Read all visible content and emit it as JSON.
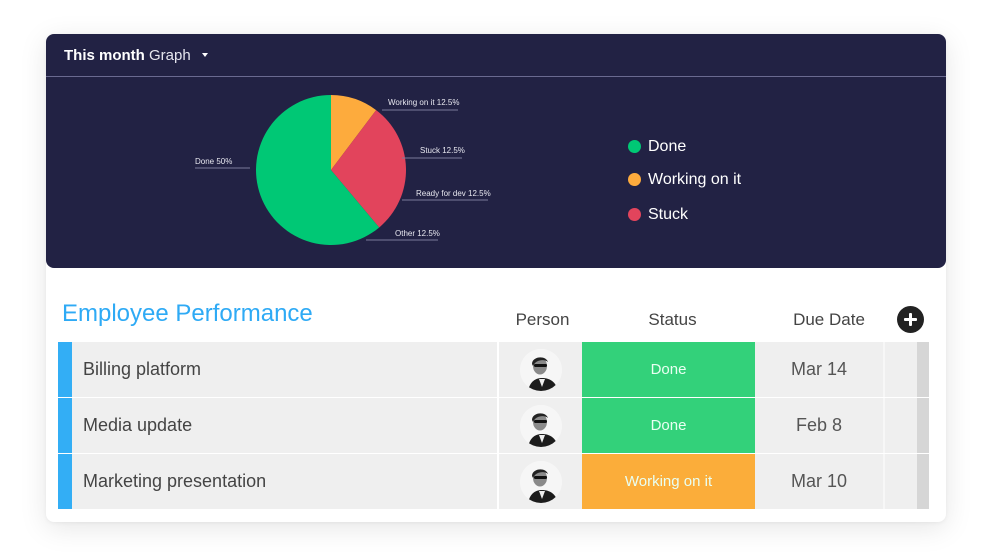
{
  "graph": {
    "title_bold": "This month",
    "title_light": "Graph",
    "dropdown_icon": "caret-down-icon"
  },
  "chart_data": {
    "type": "pie",
    "title": "This month Graph",
    "slices": [
      {
        "label": "Working on it",
        "value": 12.5,
        "display": "Working on it 12.5%",
        "color": "#fdab3d"
      },
      {
        "label": "Stuck",
        "value": 12.5,
        "display": "Stuck 12.5%",
        "color": "#e2445c"
      },
      {
        "label": "Ready for dev",
        "value": 12.5,
        "display": "Ready for dev 12.5%",
        "color": "#e2445c"
      },
      {
        "label": "Other",
        "value": 12.5,
        "display": "Other 12.5%",
        "color": "#00c875"
      },
      {
        "label": "Done",
        "value": 50,
        "display": "Done 50%",
        "color": "#00c875"
      }
    ],
    "legend": [
      {
        "label": "Done",
        "color": "#00c875"
      },
      {
        "label": "Working on it",
        "color": "#fdab3d"
      },
      {
        "label": "Stuck",
        "color": "#e2445c"
      }
    ],
    "legend_position": "right"
  },
  "table": {
    "title": "Employee Performance",
    "columns": {
      "person": "Person",
      "status": "Status",
      "due_date": "Due Date"
    },
    "add_column_icon": "plus-circle-icon",
    "rows": [
      {
        "name": "Billing platform",
        "status": "Done",
        "status_color": "#33d17a",
        "due": "Mar 14"
      },
      {
        "name": "Media update",
        "status": "Done",
        "status_color": "#33d17a",
        "due": "Feb 8"
      },
      {
        "name": "Marketing presentation",
        "status": "Working on it",
        "status_color": "#fbad3a",
        "due": "Mar 10"
      }
    ]
  },
  "colors": {
    "panel_bg": "#222244",
    "accent_blue": "#2eaaf5",
    "done_green": "#00c875",
    "working_orange": "#fdab3d",
    "stuck_red": "#e2445c"
  }
}
